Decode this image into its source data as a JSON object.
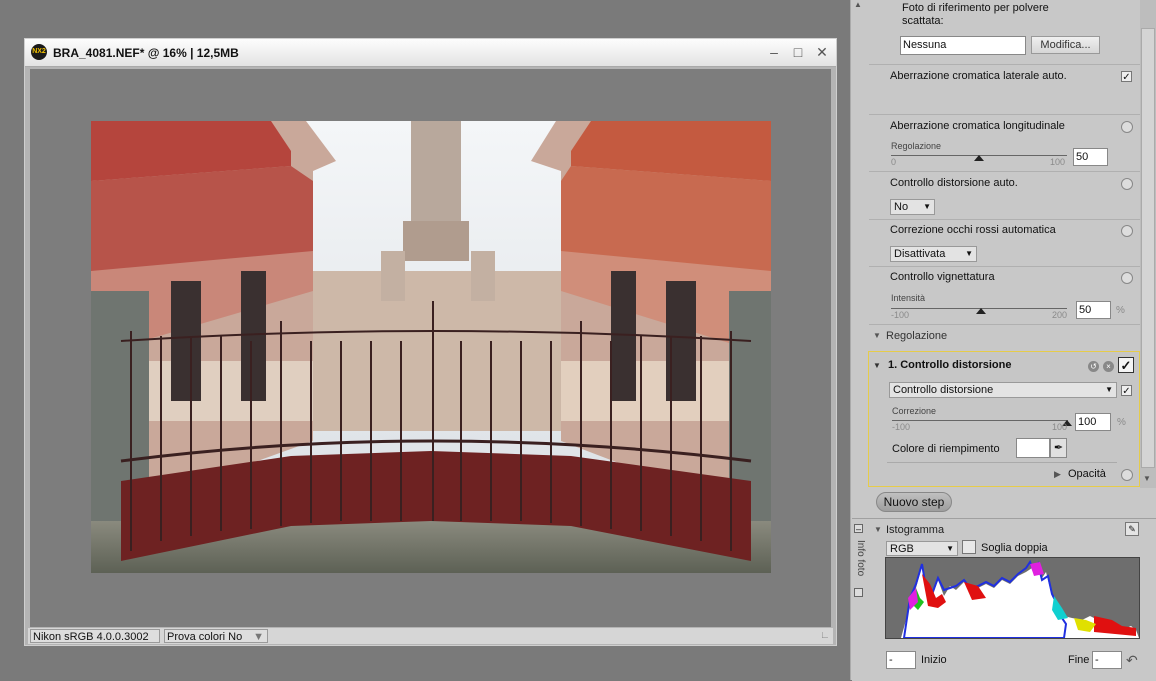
{
  "window": {
    "title": "BRA_4081.NEF* @ 16% | 12,5MB",
    "logo": "NX2",
    "minimize_icon": "minimize-icon",
    "maximize_icon": "maximize-icon",
    "close_icon": "close-icon"
  },
  "statusbar": {
    "profile": "Nikon sRGB 4.0.0.3002",
    "softproof": "Prova colori No"
  },
  "panel": {
    "dust_ref_label": "Foto di riferimento per polvere scattata:",
    "dust_ref_value": "Nessuna",
    "dust_ref_button": "Modifica...",
    "lat_ca_label": "Aberrazione cromatica laterale auto.",
    "lat_ca_checked": "✓",
    "long_ca_label": "Aberrazione cromatica longitudinale",
    "long_ca_slider_label": "Regolazione",
    "long_ca_min": "0",
    "long_ca_max": "100",
    "long_ca_value": "50",
    "dist_auto_label": "Controllo distorsione auto.",
    "dist_auto_value": "No",
    "redeye_label": "Correzione occhi rossi automatica",
    "redeye_value": "Disattivata",
    "vignette_label": "Controllo vignettatura",
    "vignette_slider_label": "Intensità",
    "vignette_min": "-100",
    "vignette_max": "200",
    "vignette_value": "50",
    "vignette_unit": "%",
    "adjust_header": "Regolazione",
    "step_title": "1. Controllo distorsione",
    "step_checked": "✓",
    "step_dropdown": "Controllo distorsione",
    "step_dropdown_checked": "✓",
    "correction_label": "Correzione",
    "correction_min": "-100",
    "correction_max": "100",
    "correction_value": "100",
    "correction_unit": "%",
    "fill_color_label": "Colore di riempimento",
    "opacity_label": "Opacità",
    "new_step_button": "Nuovo step",
    "info_tab": "Info foto"
  },
  "histogram": {
    "title": "Istogramma",
    "channel": "RGB",
    "double_threshold": "Soglia doppia",
    "start_label": "Inizio",
    "start_value": "-",
    "end_label": "Fine",
    "end_value": "-"
  },
  "colors": {
    "accent_border": "#e6cc4a",
    "panel_bg": "#c8c8c8",
    "window_bg": "#b4b4b4"
  }
}
